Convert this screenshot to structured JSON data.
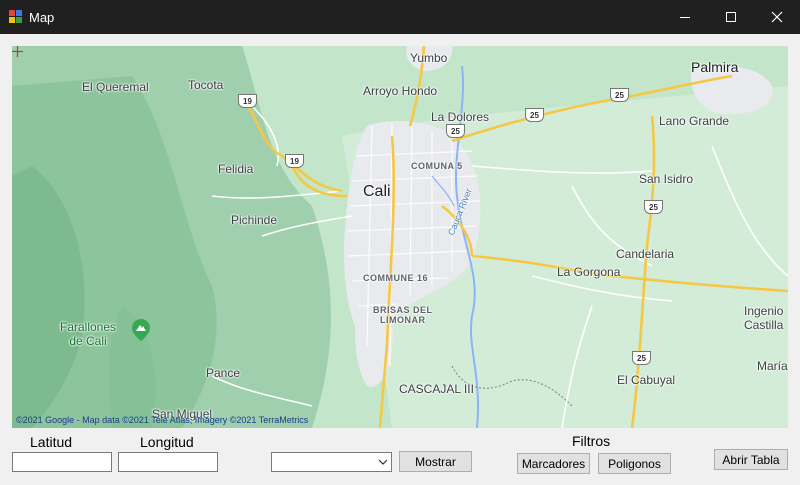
{
  "window": {
    "title": "Map",
    "controls": [
      "minimize",
      "maximize",
      "close"
    ],
    "title_bar_color": "#202020"
  },
  "map": {
    "places": {
      "yumbo": "Yumbo",
      "palmira": "Palmira",
      "el_queremal": "El Queremal",
      "tocota": "Tocota",
      "arroyo_hondo": "Arroyo Hondo",
      "la_dolores": "La Dolores",
      "lano_grande": "Lano Grande",
      "felidia": "Felidia",
      "comuna_5": "COMUNA 5",
      "cali": "Cali",
      "san_isidro": "San Isidro",
      "pichinde": "Pichinde",
      "cauca_river": "Cauca River",
      "candelaria": "Candelaria",
      "la_gorgona": "La Gorgona",
      "commune_16": "COMMUNE 16",
      "brisas_del_limonar": "BRISAS DEL\nLIMONAR",
      "farallones": "Farallones\nde Cali",
      "ingenio_castilla": "Ingenio\nCastilla",
      "pance": "Pance",
      "el_cabuyal": "El Cabuyal",
      "maria": "María",
      "cascajal": "CASCAJAL III",
      "san_miguel": "San Miguel"
    },
    "shields": [
      "19",
      "19",
      "25",
      "25",
      "25",
      "25",
      "25"
    ],
    "attribution": "©2021 Google - Map data ©2021 Tele Atlas, Imagery ©2021 TerraMetrics",
    "marker_icon": "crosshair-marker-icon",
    "colors": {
      "terrain": "#b9dfc3",
      "urban": "#e8eaed",
      "highway": "#f6c744",
      "water": "#8ab4f8",
      "marker": "#d93025"
    }
  },
  "controls": {
    "latitud_label": "Latitud",
    "longitud_label": "Longitud",
    "latitud_value": "",
    "longitud_value": "",
    "filter_select_value": "",
    "mostrar_button": "Mostrar",
    "filtros_label": "Filtros",
    "marcadores_button": "Marcadores",
    "poligonos_button": "Poligonos",
    "abrir_tabla_button": "Abrir Tabla"
  }
}
